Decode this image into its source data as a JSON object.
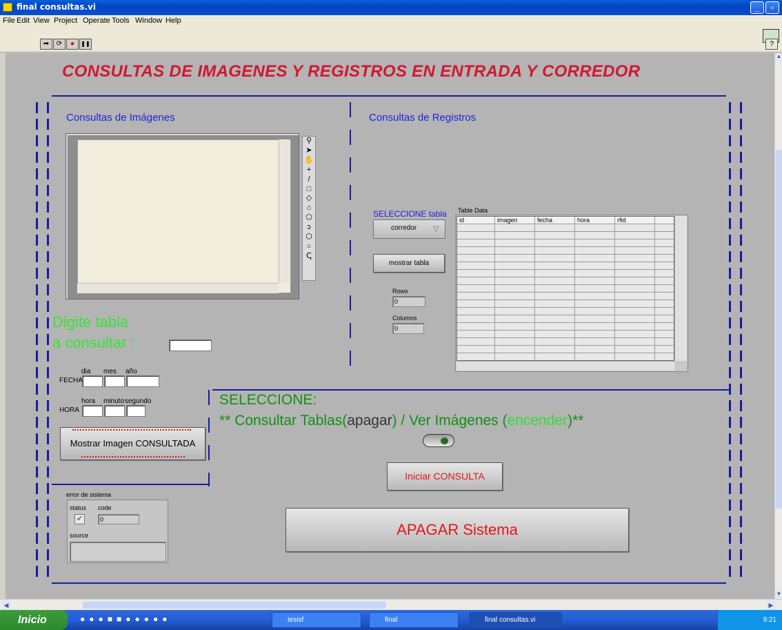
{
  "window": {
    "title": "final consultas.vi"
  },
  "menu": [
    "File",
    "Edit",
    "View",
    "Project",
    "Operate",
    "Tools",
    "Window",
    "Help"
  ],
  "toolbar": {
    "run": "➡",
    "run_continuous": "⟳",
    "abort": "●",
    "pause": "❚❚",
    "help": "?"
  },
  "panel": {
    "main_title": "CONSULTAS DE IMAGENES Y REGISTROS  EN ENTRADA Y CORREDOR",
    "images_section": "Consultas de Imágenes",
    "records_section": "Consultas de Registros",
    "digite_line1": "Digite tabla",
    "digite_line2": "a consultar :",
    "fecha": {
      "label": "FECHA",
      "dia": "dia",
      "mes": "mes",
      "anio": "año"
    },
    "hora": {
      "label": "HORA",
      "hora": "hora",
      "minuto": "minuto",
      "segundo": "segundo"
    },
    "mostrar_imagen_btn": "Mostrar Imagen CONSULTADA",
    "seleccione_tabla_label": "SELECCIONE tabla",
    "tabla_ring_value": "corredor",
    "mostrar_tabla_btn": "mostrar tabla",
    "rows_label": "Rows",
    "rows_value": "0",
    "columns_label": "Columns",
    "columns_value": "0",
    "table_label": "Table Data",
    "table_headers": [
      "id",
      "imagen",
      "fecha",
      "hora",
      "rfid",
      ""
    ],
    "seleccione_title": "SELECCIONE:",
    "seleccione_pre": "** Consultar Tablas(",
    "seleccione_apagar": "apagar",
    "seleccione_mid": ") / Ver Imágenes (",
    "seleccione_encender": "encender",
    "seleccione_post": ")**",
    "iniciar_btn": "Iniciar CONSULTA",
    "apagar_btn": "APAGAR  Sistema",
    "error": {
      "label": "error de sistema",
      "status": "status",
      "code": "code",
      "code_value": "0",
      "source": "source"
    }
  },
  "taskbar": {
    "start": "Inicio",
    "tasks": [
      "tesisf",
      "final",
      "final consultas.vi"
    ],
    "clock": "9:21"
  },
  "colors": {
    "title_red": "#d01830",
    "digite_green": "#33e633",
    "section_blue": "#2222dd",
    "seleccione_green": "#109010",
    "iniciar_red": "#e01818"
  }
}
